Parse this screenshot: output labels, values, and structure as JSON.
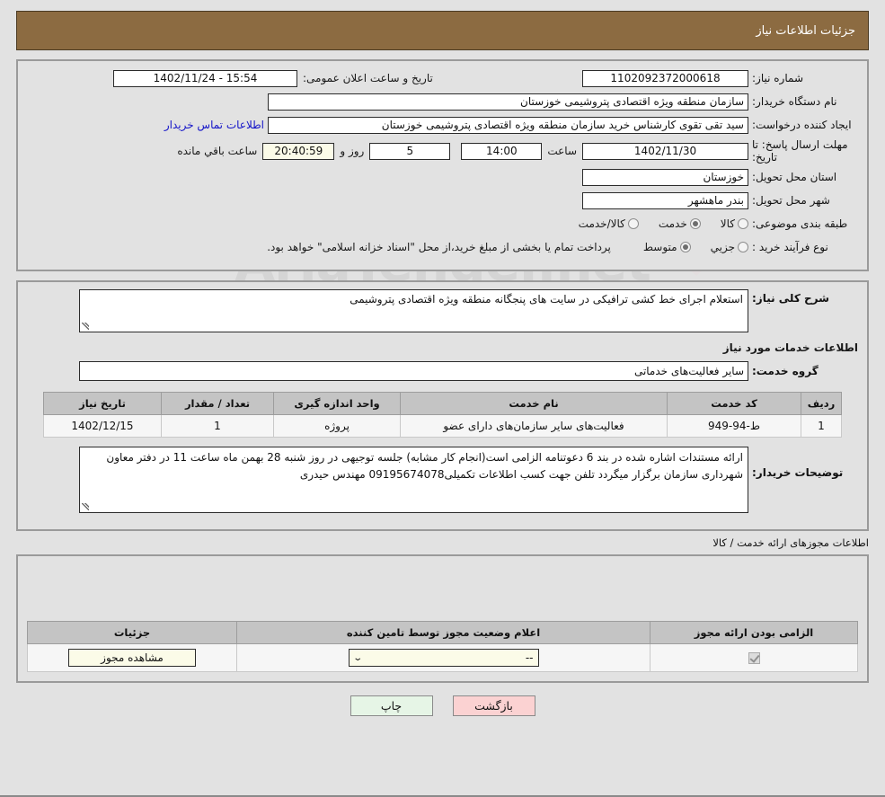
{
  "header": {
    "title": "جزئیات اطلاعات نیاز"
  },
  "top_form": {
    "need_number_label": "شماره نیاز:",
    "need_number_value": "1102092372000618",
    "public_announce_label": "تاریخ و ساعت اعلان عمومی:",
    "public_announce_value": "15:54 - 1402/11/24",
    "buyer_org_label": "نام دستگاه خریدار:",
    "buyer_org_value": "سازمان منطقه ویژه اقتصادی پتروشیمی خوزستان",
    "creator_label": "ایجاد کننده درخواست:",
    "creator_value": "سید تقی تقوی کارشناس خرید سازمان منطقه ویژه اقتصادی پتروشیمی خوزستان",
    "contact_link": "اطلاعات تماس خریدار",
    "deadline_label": "مهلت ارسال پاسخ: تا تاریخ:",
    "deadline_date": "1402/11/30",
    "hour_label": "ساعت",
    "deadline_time": "14:00",
    "days_value": "5",
    "days_label": "روز و",
    "countdown_value": "20:40:59",
    "remaining_label": "ساعت باقي مانده",
    "province_label": "استان محل تحویل:",
    "province_value": "خوزستان",
    "city_label": "شهر محل تحویل:",
    "city_value": "بندر ماهشهر",
    "category_label": "طبقه بندی موضوعی:",
    "category_options": [
      {
        "label": "کالا",
        "selected": false
      },
      {
        "label": "خدمت",
        "selected": true
      },
      {
        "label": "کالا/خدمت",
        "selected": false
      }
    ],
    "purchase_type_label": "نوع فرآیند خرید :",
    "purchase_type_options": [
      {
        "label": "جزیي",
        "selected": false
      },
      {
        "label": "متوسط",
        "selected": true
      }
    ],
    "treasury_note": "پرداخت تمام یا بخشی از مبلغ خرید،از محل \"اسناد خزانه اسلامی\" خواهد بود."
  },
  "description": {
    "summary_label": "شرح کلی نیاز:",
    "summary_value": "استعلام اجرای خط کشی ترافیکی در سایت های پنجگانه منطقه ویژه اقتصادی پتروشیمی",
    "services_section_title": "اطلاعات خدمات مورد نیاز",
    "service_group_label": "گروه خدمت:",
    "service_group_value": "سایر فعالیت‌های خدماتی"
  },
  "items_table": {
    "columns": [
      "ردیف",
      "کد خدمت",
      "نام خدمت",
      "واحد اندازه گیری",
      "تعداد / مقدار",
      "تاریخ نیاز"
    ],
    "rows": [
      {
        "row": "1",
        "code": "ط-94-949",
        "name": "فعالیت‌های سایر سازمان‌های دارای عضو",
        "unit": "پروژه",
        "quantity": "1",
        "need_date": "1402/12/15"
      }
    ]
  },
  "buyer_notes": {
    "label": "توضیحات خریدار:",
    "value": "ارائه مستندات اشاره شده در بند 6 دعوتنامه الزامی است(انجام کار مشابه) جلسه توجیهی در روز شنبه 28 بهمن ماه ساعت 11 در دفتر معاون شهرداری سازمان برگزار میگردد تلفن جهت کسب اطلاعات تکمیلی09195674078 مهندس حیدری"
  },
  "permits": {
    "caption": "اطلاعات مجوزهای ارائه خدمت / کالا",
    "columns": [
      "الزامی بودن ارائه مجوز",
      "اعلام وضعیت مجوز توسط تامین کننده",
      "جزئیات"
    ],
    "rows": [
      {
        "required": true,
        "status_value": "--",
        "detail_button": "مشاهده مجوز"
      }
    ]
  },
  "footer": {
    "print_label": "چاپ",
    "back_label": "بازگشت"
  },
  "watermark": {
    "text": "AriaTender.net"
  },
  "colors": {
    "header_bg": "#8c6b41",
    "page_bg": "#e2e2e2",
    "link": "#1414c8",
    "cream_field": "#fbfbe8",
    "print_btn": "#e6f5e6",
    "back_btn": "#fbd2d2",
    "table_header": "#c4c4c4"
  }
}
